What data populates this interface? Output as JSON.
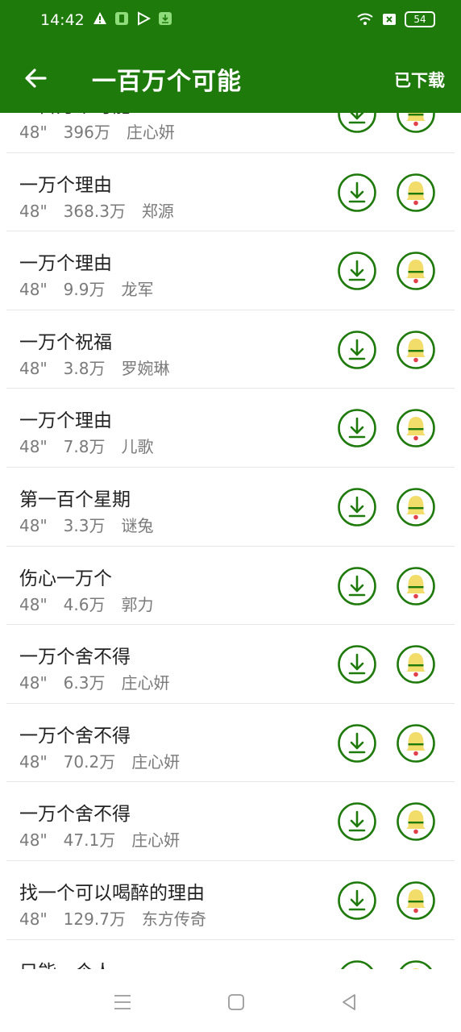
{
  "status_bar": {
    "time": "14:42",
    "battery": "54",
    "icons_left": [
      "warning-icon",
      "app-notification-icon",
      "play-store-icon",
      "download-notification-icon"
    ],
    "icons_right": [
      "wifi-icon",
      "sim-card-icon",
      "battery-icon"
    ]
  },
  "header": {
    "title": "一百万个可能",
    "action_label": "已下载",
    "back_icon": "arrow-left-icon"
  },
  "colors": {
    "primary": "#1f7a0c",
    "text_primary": "#222222",
    "text_secondary": "#7a7a7a",
    "bell": "#f2dc6a",
    "bell_clapper": "#e0404a"
  },
  "songs": [
    {
      "title": "一百万个可能",
      "duration": "48\"",
      "plays": "396万",
      "artist": "庄心妍"
    },
    {
      "title": "一万个理由",
      "duration": "48\"",
      "plays": "368.3万",
      "artist": "郑源"
    },
    {
      "title": "一万个理由",
      "duration": "48\"",
      "plays": "9.9万",
      "artist": "龙军"
    },
    {
      "title": "一万个祝福",
      "duration": "48\"",
      "plays": "3.8万",
      "artist": "罗婉琳"
    },
    {
      "title": "一万个理由",
      "duration": "48\"",
      "plays": "7.8万",
      "artist": "儿歌"
    },
    {
      "title": "第一百个星期",
      "duration": "48\"",
      "plays": "3.3万",
      "artist": "谜兔"
    },
    {
      "title": "伤心一万个",
      "duration": "48\"",
      "plays": "4.6万",
      "artist": "郭力"
    },
    {
      "title": "一万个舍不得",
      "duration": "48\"",
      "plays": "6.3万",
      "artist": "庄心妍"
    },
    {
      "title": "一万个舍不得",
      "duration": "48\"",
      "plays": "70.2万",
      "artist": "庄心妍"
    },
    {
      "title": "一万个舍不得",
      "duration": "48\"",
      "plays": "47.1万",
      "artist": "庄心妍"
    },
    {
      "title": "找一个可以喝醉的理由",
      "duration": "48\"",
      "plays": "129.7万",
      "artist": "东方传奇"
    },
    {
      "title": "只能一个人",
      "duration": "",
      "plays": "",
      "artist": ""
    }
  ],
  "nav_bar": {
    "menu_icon": "menu-icon",
    "home_icon": "home-square-icon",
    "back_icon": "back-triangle-icon"
  }
}
